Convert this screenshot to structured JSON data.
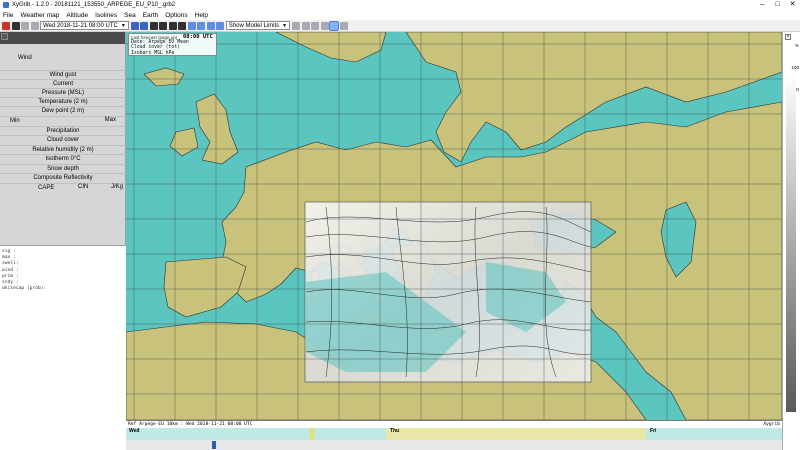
{
  "window": {
    "title": "XyGrib - 1.2.0 - 20181121_153550_ARPEGE_EU_P10_.grb2"
  },
  "menu": [
    "File",
    "Weather map",
    "Altitude",
    "Isolines",
    "Sea",
    "Earth",
    "Options",
    "Help"
  ],
  "toolbar": {
    "date_combo": "Wed 2018-11-21 08:00 UTC",
    "limits_combo": "Show Model Limits"
  },
  "layers": [
    {
      "label": "Wind"
    },
    {
      "label": "Wind gust"
    },
    {
      "label": "Current"
    },
    {
      "label": "Pressure (MSL)"
    },
    {
      "label": "Temperature (2 m)"
    },
    {
      "label": "Dew point (2 m)"
    },
    {
      "label": "Precipitation"
    },
    {
      "label": "Cloud cover"
    },
    {
      "label": "Relative humidity (2 m)"
    },
    {
      "label": "Isotherm 0°C"
    },
    {
      "label": "Snow depth"
    },
    {
      "label": "Composite Reflectivity"
    },
    {
      "label": "CAPE"
    }
  ],
  "minmax": {
    "min": "Min",
    "max": "Max"
  },
  "cape_extra": {
    "cin": "CIN",
    "unit": "J/Kg"
  },
  "data_lines": [
    "sig :",
    "max :",
    "swell:",
    "wind :",
    "prim :",
    "scdy :",
    "whitecap (prob):"
  ],
  "infobox": {
    "tooltip": "Last forecast (page up)",
    "date_line": "Date: Arpege EU Mean",
    "cloud": "Cloud cover  (tot)",
    "isobars": "Isobars MSL  hPa",
    "time_right": "08:00 UTC"
  },
  "forecast_bar": {
    "text": "Ref Arpege-EU 10km : Wed 2018-11-21 08:00 UTC",
    "brand": "Xygrib"
  },
  "timeline": {
    "day1": "Wed",
    "day2": "Thu",
    "day3": "Fri"
  },
  "colorbar": {
    "ticks": [
      "%",
      "100",
      "90"
    ]
  },
  "colors": {
    "sea": "#5bc5bf",
    "land": "#c8c27a",
    "grid": "#3d4a4a"
  }
}
